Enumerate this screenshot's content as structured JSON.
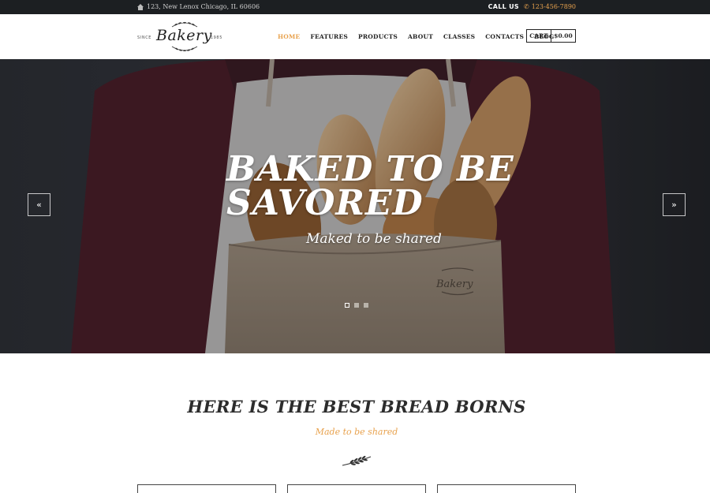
{
  "topbar": {
    "address": "123, New Lenox Chicago, IL 60606",
    "call_label": "CALL US",
    "phone": "123-456-7890"
  },
  "logo": {
    "since": "SINCE",
    "name": "Bakery",
    "year": "1985"
  },
  "nav": {
    "items": [
      {
        "label": "HOME",
        "active": true
      },
      {
        "label": "FEATURES",
        "active": false
      },
      {
        "label": "PRODUCTS",
        "active": false
      },
      {
        "label": "ABOUT",
        "active": false
      },
      {
        "label": "CLASSES",
        "active": false
      },
      {
        "label": "CONTACTS",
        "active": false
      },
      {
        "label": "BLOG",
        "active": false
      }
    ]
  },
  "cart": {
    "label": "CART",
    "amount": "$0.00"
  },
  "hero": {
    "title_line1": "BAKED TO BE",
    "title_line2": "SAVORED",
    "subtitle": "Maked to be shared",
    "prev_icon": "«",
    "next_icon": "»",
    "bag_logo": "Bakery",
    "slides": 3,
    "active_slide": 1
  },
  "intro": {
    "title": "HERE IS THE BEST BREAD BORNS",
    "subtitle": "Made to be shared"
  },
  "colors": {
    "accent": "#e8a24e",
    "topbar": "#1c1f22",
    "text": "#2a2a2a"
  },
  "icons": {
    "address": "home-icon",
    "phone": "phone-icon",
    "divider": "wheat-icon"
  }
}
